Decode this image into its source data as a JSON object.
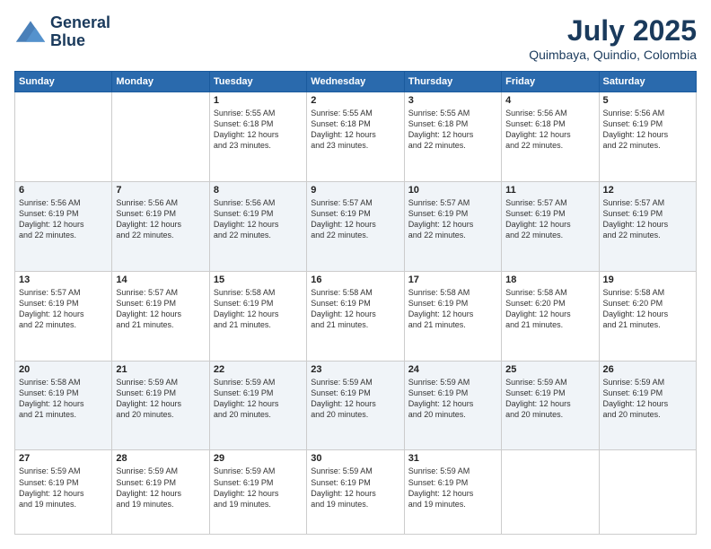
{
  "header": {
    "logo_line1": "General",
    "logo_line2": "Blue",
    "month_year": "July 2025",
    "location": "Quimbaya, Quindio, Colombia"
  },
  "weekdays": [
    "Sunday",
    "Monday",
    "Tuesday",
    "Wednesday",
    "Thursday",
    "Friday",
    "Saturday"
  ],
  "weeks": [
    [
      {
        "day": "",
        "info": ""
      },
      {
        "day": "",
        "info": ""
      },
      {
        "day": "1",
        "info": "Sunrise: 5:55 AM\nSunset: 6:18 PM\nDaylight: 12 hours\nand 23 minutes."
      },
      {
        "day": "2",
        "info": "Sunrise: 5:55 AM\nSunset: 6:18 PM\nDaylight: 12 hours\nand 23 minutes."
      },
      {
        "day": "3",
        "info": "Sunrise: 5:55 AM\nSunset: 6:18 PM\nDaylight: 12 hours\nand 22 minutes."
      },
      {
        "day": "4",
        "info": "Sunrise: 5:56 AM\nSunset: 6:18 PM\nDaylight: 12 hours\nand 22 minutes."
      },
      {
        "day": "5",
        "info": "Sunrise: 5:56 AM\nSunset: 6:19 PM\nDaylight: 12 hours\nand 22 minutes."
      }
    ],
    [
      {
        "day": "6",
        "info": "Sunrise: 5:56 AM\nSunset: 6:19 PM\nDaylight: 12 hours\nand 22 minutes."
      },
      {
        "day": "7",
        "info": "Sunrise: 5:56 AM\nSunset: 6:19 PM\nDaylight: 12 hours\nand 22 minutes."
      },
      {
        "day": "8",
        "info": "Sunrise: 5:56 AM\nSunset: 6:19 PM\nDaylight: 12 hours\nand 22 minutes."
      },
      {
        "day": "9",
        "info": "Sunrise: 5:57 AM\nSunset: 6:19 PM\nDaylight: 12 hours\nand 22 minutes."
      },
      {
        "day": "10",
        "info": "Sunrise: 5:57 AM\nSunset: 6:19 PM\nDaylight: 12 hours\nand 22 minutes."
      },
      {
        "day": "11",
        "info": "Sunrise: 5:57 AM\nSunset: 6:19 PM\nDaylight: 12 hours\nand 22 minutes."
      },
      {
        "day": "12",
        "info": "Sunrise: 5:57 AM\nSunset: 6:19 PM\nDaylight: 12 hours\nand 22 minutes."
      }
    ],
    [
      {
        "day": "13",
        "info": "Sunrise: 5:57 AM\nSunset: 6:19 PM\nDaylight: 12 hours\nand 22 minutes."
      },
      {
        "day": "14",
        "info": "Sunrise: 5:57 AM\nSunset: 6:19 PM\nDaylight: 12 hours\nand 21 minutes."
      },
      {
        "day": "15",
        "info": "Sunrise: 5:58 AM\nSunset: 6:19 PM\nDaylight: 12 hours\nand 21 minutes."
      },
      {
        "day": "16",
        "info": "Sunrise: 5:58 AM\nSunset: 6:19 PM\nDaylight: 12 hours\nand 21 minutes."
      },
      {
        "day": "17",
        "info": "Sunrise: 5:58 AM\nSunset: 6:19 PM\nDaylight: 12 hours\nand 21 minutes."
      },
      {
        "day": "18",
        "info": "Sunrise: 5:58 AM\nSunset: 6:20 PM\nDaylight: 12 hours\nand 21 minutes."
      },
      {
        "day": "19",
        "info": "Sunrise: 5:58 AM\nSunset: 6:20 PM\nDaylight: 12 hours\nand 21 minutes."
      }
    ],
    [
      {
        "day": "20",
        "info": "Sunrise: 5:58 AM\nSunset: 6:19 PM\nDaylight: 12 hours\nand 21 minutes."
      },
      {
        "day": "21",
        "info": "Sunrise: 5:59 AM\nSunset: 6:19 PM\nDaylight: 12 hours\nand 20 minutes."
      },
      {
        "day": "22",
        "info": "Sunrise: 5:59 AM\nSunset: 6:19 PM\nDaylight: 12 hours\nand 20 minutes."
      },
      {
        "day": "23",
        "info": "Sunrise: 5:59 AM\nSunset: 6:19 PM\nDaylight: 12 hours\nand 20 minutes."
      },
      {
        "day": "24",
        "info": "Sunrise: 5:59 AM\nSunset: 6:19 PM\nDaylight: 12 hours\nand 20 minutes."
      },
      {
        "day": "25",
        "info": "Sunrise: 5:59 AM\nSunset: 6:19 PM\nDaylight: 12 hours\nand 20 minutes."
      },
      {
        "day": "26",
        "info": "Sunrise: 5:59 AM\nSunset: 6:19 PM\nDaylight: 12 hours\nand 20 minutes."
      }
    ],
    [
      {
        "day": "27",
        "info": "Sunrise: 5:59 AM\nSunset: 6:19 PM\nDaylight: 12 hours\nand 19 minutes."
      },
      {
        "day": "28",
        "info": "Sunrise: 5:59 AM\nSunset: 6:19 PM\nDaylight: 12 hours\nand 19 minutes."
      },
      {
        "day": "29",
        "info": "Sunrise: 5:59 AM\nSunset: 6:19 PM\nDaylight: 12 hours\nand 19 minutes."
      },
      {
        "day": "30",
        "info": "Sunrise: 5:59 AM\nSunset: 6:19 PM\nDaylight: 12 hours\nand 19 minutes."
      },
      {
        "day": "31",
        "info": "Sunrise: 5:59 AM\nSunset: 6:19 PM\nDaylight: 12 hours\nand 19 minutes."
      },
      {
        "day": "",
        "info": ""
      },
      {
        "day": "",
        "info": ""
      }
    ]
  ]
}
